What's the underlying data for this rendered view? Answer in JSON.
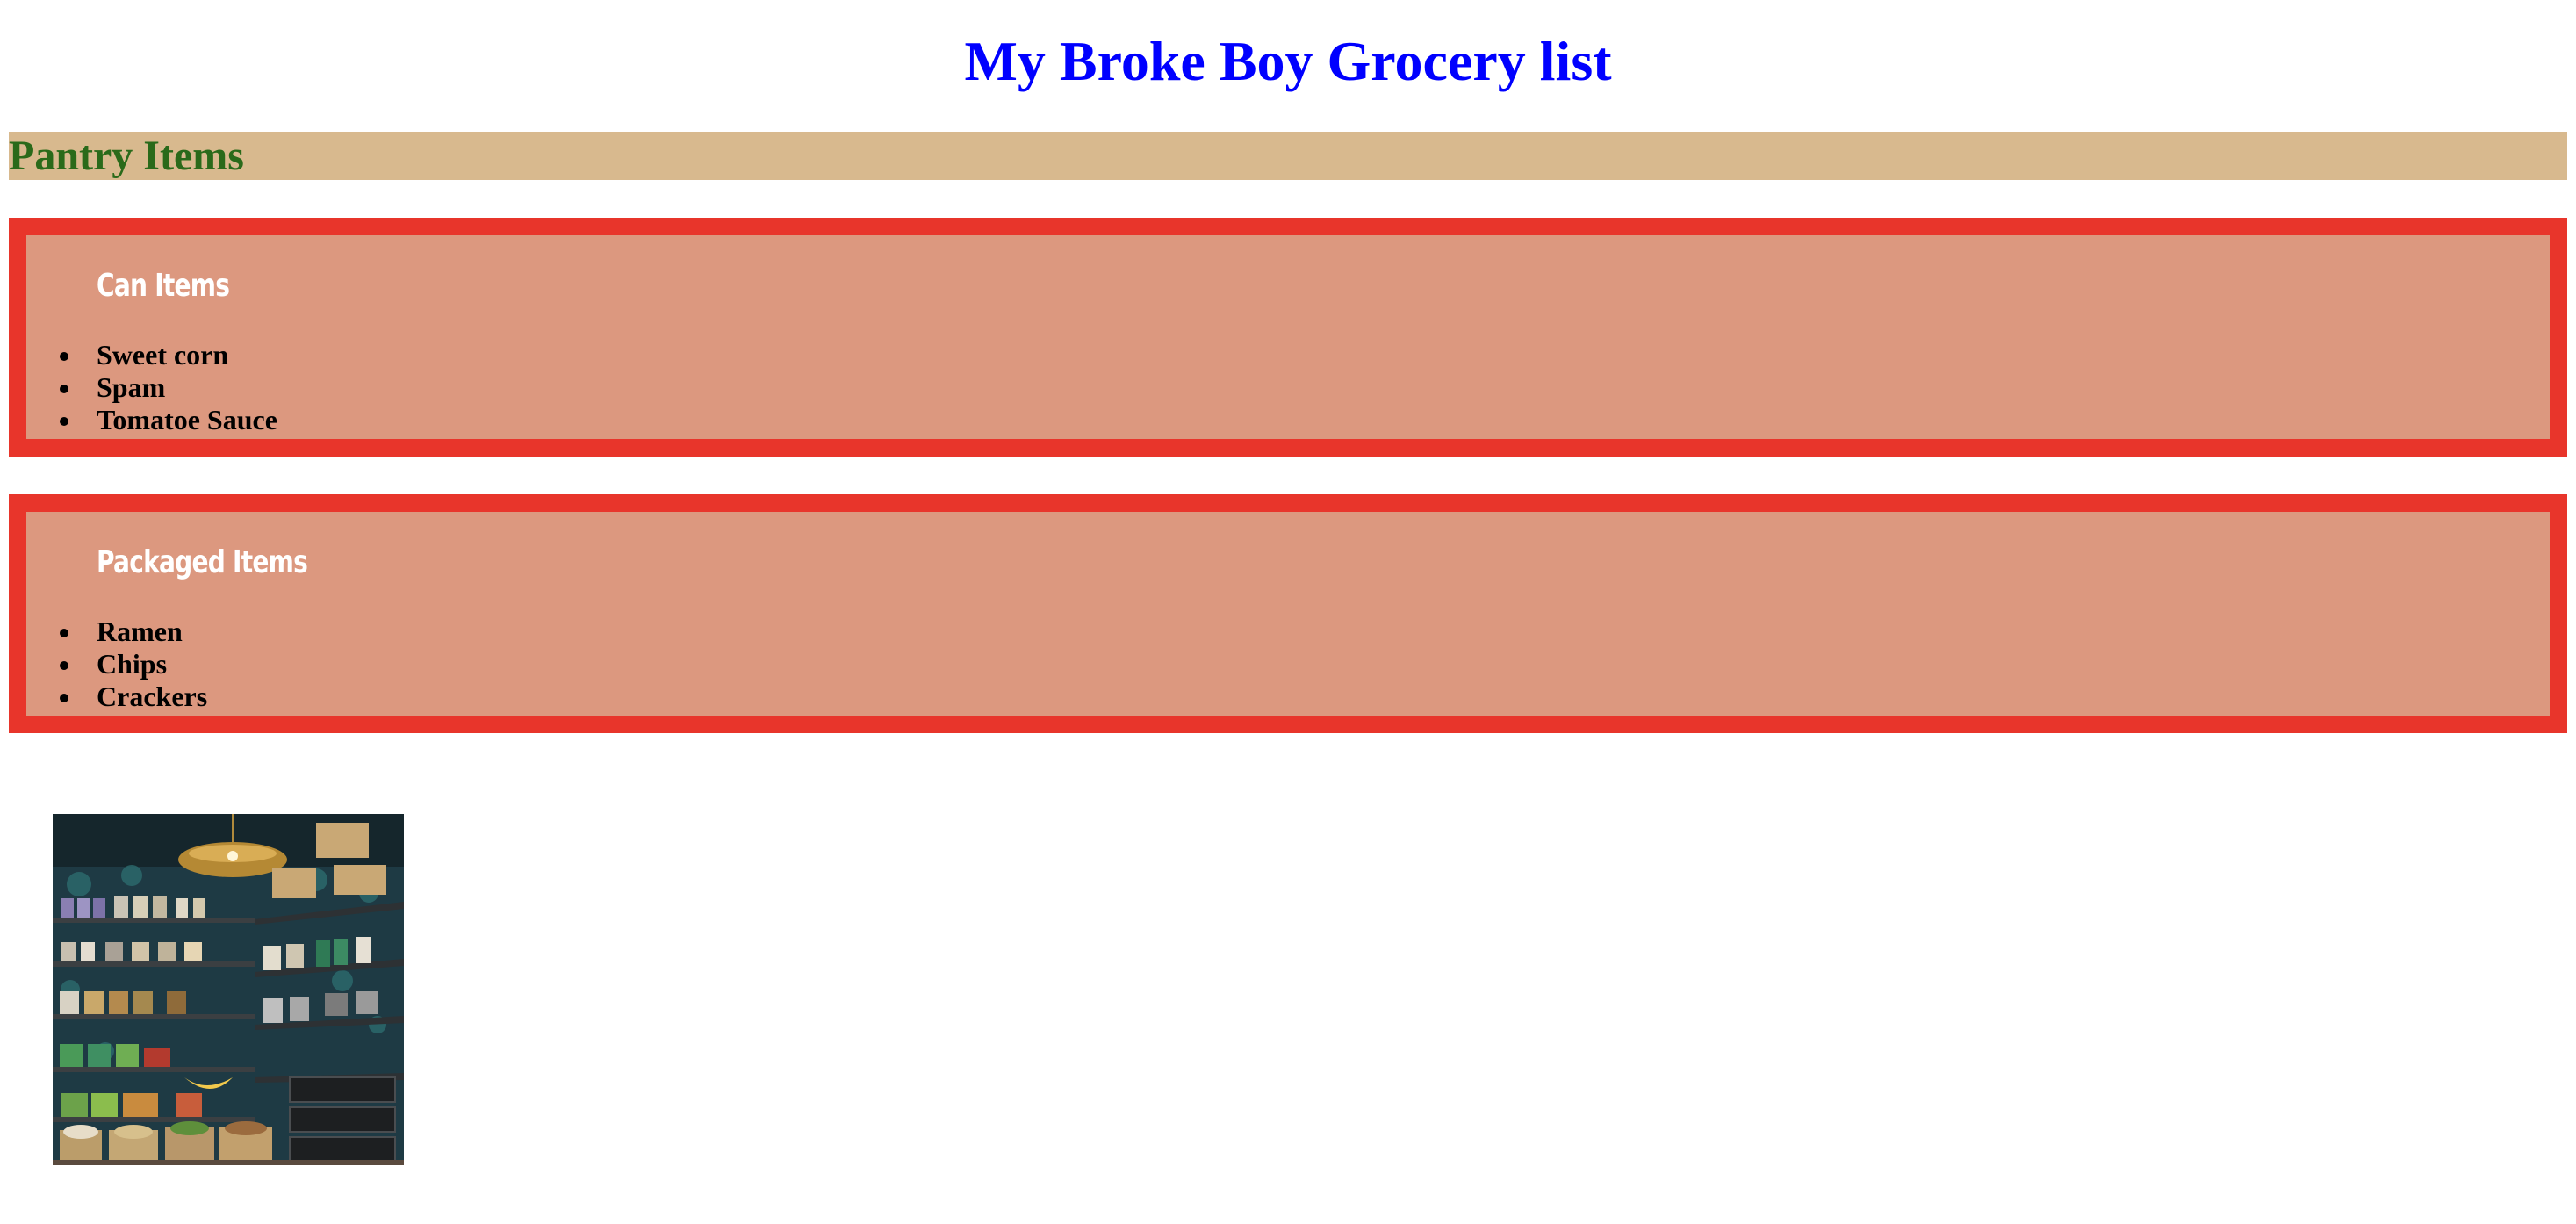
{
  "page": {
    "title": "My Broke Boy Grocery list",
    "title_color": "#0000ff"
  },
  "section": {
    "label": "Pantry Items",
    "label_color": "#2a6a1a",
    "background": "#d8b98e"
  },
  "groups": [
    {
      "heading": "Can Items",
      "items": [
        "Sweet corn",
        "Spam",
        "Tomatoe Sauce"
      ]
    },
    {
      "heading": "Packaged Items",
      "items": [
        "Ramen",
        "Chips",
        "Crackers"
      ]
    }
  ],
  "colors": {
    "group_border": "#e8352b",
    "group_background": "#dc987f",
    "group_heading": "#ffffff"
  },
  "image": {
    "subject": "pantry-shelves-photo"
  }
}
